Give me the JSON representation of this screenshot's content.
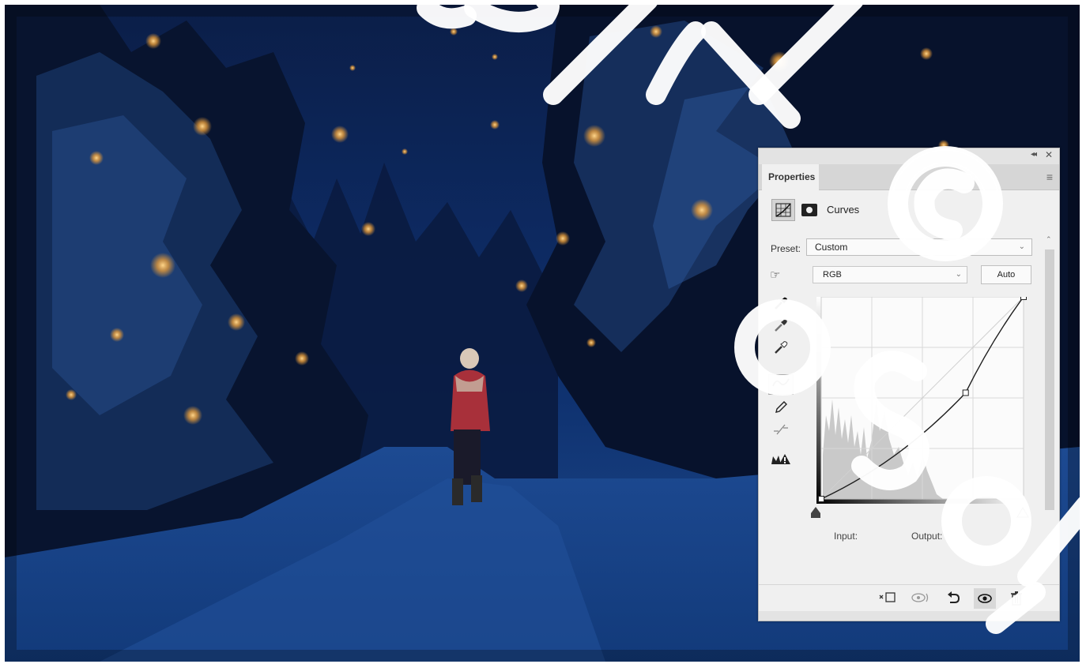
{
  "panel": {
    "tab_label": "Properties",
    "collapse_icon": "◂◂",
    "close_icon": "✕",
    "menu_icon": "≡",
    "adjustment_label": "Curves",
    "preset_label": "Preset:",
    "preset_value": "Custom",
    "channel_value": "RGB",
    "auto_label": "Auto",
    "input_label": "Input:",
    "output_label": "Output:"
  },
  "curve_points": [
    {
      "input": 0,
      "output": 0
    },
    {
      "input": 182,
      "output": 134
    },
    {
      "input": 255,
      "output": 255
    }
  ],
  "colors": {
    "panel_bg": "#f0f0f0",
    "scene_sky": "#0d2960",
    "lantern_glow": "#f2b45a"
  }
}
